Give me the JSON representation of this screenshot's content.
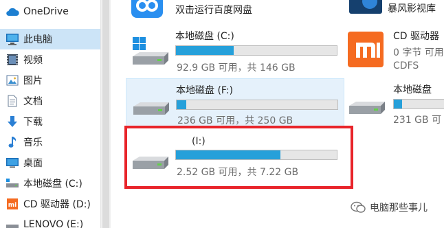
{
  "sidebar": {
    "items": [
      {
        "label": "OneDrive",
        "icon": "cloud-icon",
        "selected": false
      },
      {
        "label": "此电脑",
        "icon": "computer-icon",
        "selected": true
      },
      {
        "label": "视频",
        "icon": "video-icon",
        "selected": false
      },
      {
        "label": "图片",
        "icon": "picture-icon",
        "selected": false
      },
      {
        "label": "文档",
        "icon": "document-icon",
        "selected": false
      },
      {
        "label": "下载",
        "icon": "download-icon",
        "selected": false
      },
      {
        "label": "音乐",
        "icon": "music-icon",
        "selected": false
      },
      {
        "label": "桌面",
        "icon": "desktop-icon",
        "selected": false
      },
      {
        "label": "本地磁盘 (C:)",
        "icon": "drive-icon",
        "selected": false
      },
      {
        "label": "CD 驱动器 (D:) ",
        "icon": "cd-drive-icon",
        "selected": false
      },
      {
        "label": "LENOVO (E:)",
        "icon": "drive-icon",
        "selected": false
      }
    ]
  },
  "content": {
    "top_app": {
      "label": "双击运行百度网盘",
      "icon": "baidu-netdisk-icon"
    },
    "top_right_label": "暴风影视库",
    "drives": [
      {
        "name": "本地磁盘 (C:)",
        "info": "92.9 GB 可用，共 146 GB",
        "used_fraction": 0.36,
        "icon": "windows-drive-icon"
      },
      {
        "name": "CD 驱动器",
        "info1": "0 字节 可用",
        "info2": "CDFS",
        "icon": "xiaomi-icon"
      },
      {
        "name": "本地磁盘 (F:)",
        "info": "236 GB 可用，共 250 GB",
        "used_fraction": 0.06,
        "icon": "drive-icon"
      },
      {
        "name": "本地磁盘",
        "info": "231 GB 可",
        "used_fraction": 0.12,
        "icon": "drive-icon"
      },
      {
        "name": "(I:)",
        "info": "2.52 GB 可用，共 7.22 GB",
        "used_fraction": 0.65,
        "icon": "drive-icon"
      }
    ]
  },
  "watermark": {
    "text": "电脑那些事儿",
    "icon": "wechat-icon"
  },
  "colors": {
    "accent": "#26a0da",
    "highlight": "#e8242a",
    "selected": "#cce4f7"
  }
}
